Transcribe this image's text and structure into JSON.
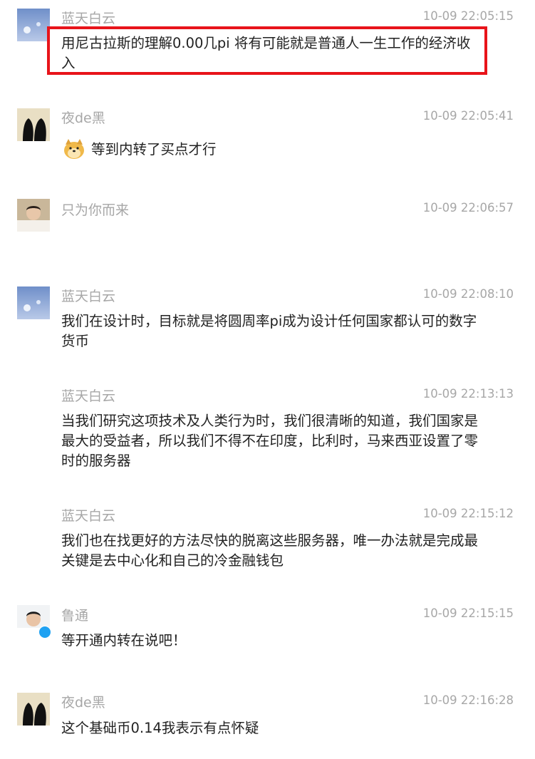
{
  "messages": [
    {
      "sender": "蓝天白云",
      "time": "10-09 22:05:15",
      "text": "用尼古拉斯的理解0.00几pi 将有可能就是普通人一生工作的经济收入",
      "highlighted": true
    },
    {
      "sender": "夜de黑",
      "time": "10-09 22:05:41",
      "text": "等到内转了买点才行",
      "emoji": "doge-emoji-icon"
    },
    {
      "sender": "只为你而来",
      "time": "10-09 22:06:57",
      "text": ""
    },
    {
      "sender": "蓝天白云",
      "time": "10-09 22:08:10",
      "text": "我们在设计时，目标就是将圆周率pi成为设计任何国家都认可的数字货币"
    },
    {
      "sender": "蓝天白云",
      "time": "10-09 22:13:13",
      "text": "当我们研究这项技术及人类行为时，我们很清晰的知道，我们国家是最大的受益者，所以我们不得不在印度，比利时，马来西亚设置了零时的服务器"
    },
    {
      "sender": "蓝天白云",
      "time": "10-09 22:15:12",
      "text": "我们也在找更好的方法尽快的脱离这些服务器，唯一办法就是完成最关键是去中心化和自己的冷金融钱包"
    },
    {
      "sender": "鲁通",
      "time": "10-09 22:15:15",
      "text": "等开通内转在说吧！"
    },
    {
      "sender": "夜de黑",
      "time": "10-09 22:16:28",
      "text": "这个基础币0.14我表示有点怀疑"
    }
  ],
  "colors": {
    "sender": "#a7a7a7",
    "text": "#222222",
    "highlight_border": "#e8141a",
    "badge": "#1ea1f2"
  }
}
